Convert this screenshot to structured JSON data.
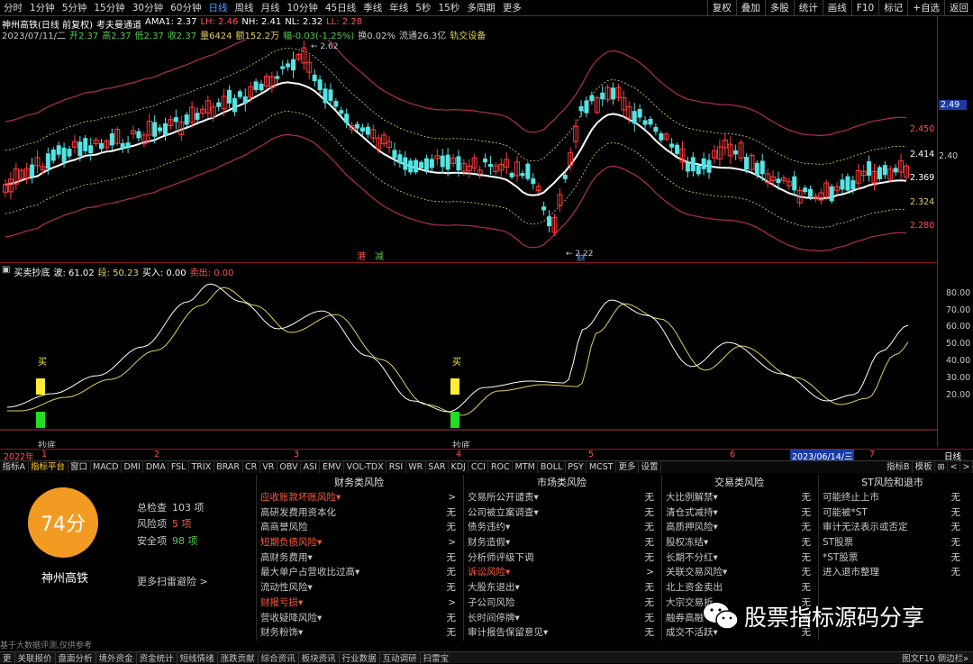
{
  "toolbar": {
    "periods": [
      "分时",
      "1分钟",
      "5分钟",
      "15分钟",
      "30分钟",
      "60分钟",
      "日线",
      "周线",
      "月线",
      "10分钟",
      "45日线",
      "季线",
      "年线",
      "5秒",
      "15秒",
      "多周期",
      "更多"
    ],
    "active_period": "日线",
    "right_buttons": [
      "复权",
      "叠加",
      "多股",
      "统计",
      "画线",
      "F10",
      "标记",
      "+自选",
      "返回"
    ]
  },
  "main_chart": {
    "name": "神州高铁(日线 前复权)",
    "indicator_name": "考夫曼通道",
    "ama_label": "AMA1: 2.37",
    "lh_label": "LH: 2.46",
    "nh_label": "NH: 2.41",
    "nl_label": "NL: 2.32",
    "ll_label": "LL: 2.28",
    "quote_date": "2023/07/11/二",
    "open": "开2.37",
    "high": "高2.37",
    "low": "低2.37",
    "close": "收2.37",
    "volume": "量6424",
    "amount": "额152.2万",
    "change": "幅-0.03(-1.25%)",
    "turnover": "换0.02%",
    "float_cap": "流通26.3亿",
    "sector": "轨交设备",
    "high_mark": "2.62",
    "low_mark": "2.22",
    "marker_1": "港",
    "marker_2": "减",
    "marker_3": "财",
    "axis_labels": [
      {
        "text": "2.49",
        "color": "#4a90ff"
      },
      {
        "text": "2.450",
        "color": "#ff5050"
      },
      {
        "text": "2.414",
        "color": "#ffffff"
      },
      {
        "text": "2.40",
        "color": "#c8c8c8"
      },
      {
        "text": "2.369",
        "color": "#ffffff"
      },
      {
        "text": "2.324",
        "color": "#e0d060"
      },
      {
        "text": "2.280",
        "color": "#ff5050"
      }
    ]
  },
  "sub_chart": {
    "name": "买卖抄底",
    "bo_label": "波: 61.02",
    "jue_label": "段: 50.23",
    "buy_label": "买入: 0.00",
    "sell_label": "卖出: 0.00",
    "buy_text": "买",
    "bottom_text": "抄底",
    "axis_labels": [
      "80.00",
      "70.00",
      "60.00",
      "50.00",
      "40.00",
      "30.00",
      "20.00"
    ]
  },
  "timeline": {
    "year": "2022年",
    "months": [
      "1",
      "2",
      "3",
      "4",
      "5",
      "6",
      "7"
    ],
    "cursor_date": "2023/06/14/三",
    "right_label": "日线"
  },
  "bottom_tabs": [
    "指标A",
    "指标平台",
    "窗口",
    "MACD",
    "DMI",
    "DMA",
    "FSL",
    "TRIX",
    "BRAR",
    "CR",
    "VR",
    "OBV",
    "ASI",
    "EMV",
    "VOL-TDX",
    "RSI",
    "WR",
    "SAR",
    "KDJ",
    "CCI",
    "ROC",
    "MTM",
    "BOLL",
    "PSY",
    "MCST",
    "更多",
    "设置"
  ],
  "bottom_tabs_right": [
    "指标B",
    "模板",
    "⊞",
    "<",
    ">"
  ],
  "score_panel": {
    "score": "74分",
    "name": "神州高铁",
    "total_label": "总检查",
    "total_value": "103 项",
    "risk_label": "风险项",
    "risk_value": "5 项",
    "safe_label": "安全项",
    "safe_value": "98 项",
    "more_link": "更多扫雷避险 >"
  },
  "risk_columns": [
    {
      "title": "财务类风险",
      "items": [
        {
          "label": "应收账款坏账风险▾",
          "value": ">",
          "alert": true
        },
        {
          "label": "高研发费用资本化",
          "value": "无",
          "alert": false
        },
        {
          "label": "高商誉风险",
          "value": "无",
          "alert": false
        },
        {
          "label": "短期负债风险▾",
          "value": ">",
          "alert": true
        },
        {
          "label": "高财务费用▾",
          "value": "无",
          "alert": false
        },
        {
          "label": "最大单户占营收比过高▾",
          "value": "无",
          "alert": false
        },
        {
          "label": "流动性风险▾",
          "value": "无",
          "alert": false
        },
        {
          "label": "财报亏损▾",
          "value": ">",
          "alert": true
        },
        {
          "label": "营收疑降风险▾",
          "value": "无",
          "alert": false
        },
        {
          "label": "财务粉饰▾",
          "value": "无",
          "alert": false
        }
      ]
    },
    {
      "title": "市场类风险",
      "items": [
        {
          "label": "交易所公开谴责▾",
          "value": "无",
          "alert": false
        },
        {
          "label": "公司被立案调查▾",
          "value": "无",
          "alert": false
        },
        {
          "label": "债务违约▾",
          "value": "无",
          "alert": false
        },
        {
          "label": "财务造假▾",
          "value": "无",
          "alert": false
        },
        {
          "label": "分析师评级下调",
          "value": "无",
          "alert": false
        },
        {
          "label": "诉讼风险▾",
          "value": ">",
          "alert": true
        },
        {
          "label": "大股东退出▾",
          "value": "无",
          "alert": false
        },
        {
          "label": "子公司风险",
          "value": "无",
          "alert": false
        },
        {
          "label": "长时间停牌▾",
          "value": "无",
          "alert": false
        },
        {
          "label": "审计报告保留意见▾",
          "value": "无",
          "alert": false
        }
      ]
    },
    {
      "title": "交易类风险",
      "items": [
        {
          "label": "大比例解禁▾",
          "value": "无",
          "alert": false
        },
        {
          "label": "清仓式减持▾",
          "value": "无",
          "alert": false
        },
        {
          "label": "高质押风险▾",
          "value": "无",
          "alert": false
        },
        {
          "label": "股权冻结▾",
          "value": "无",
          "alert": false
        },
        {
          "label": "长期不分红▾",
          "value": "无",
          "alert": false
        },
        {
          "label": "关联交易风险▾",
          "value": "无",
          "alert": false
        },
        {
          "label": "北上资金卖出",
          "value": "无",
          "alert": false
        },
        {
          "label": "大宗交易折",
          "value": "无",
          "alert": false
        },
        {
          "label": "融券高融",
          "value": "无",
          "alert": false
        },
        {
          "label": "成交不活跃▾",
          "value": "无",
          "alert": false
        }
      ]
    },
    {
      "title": "ST风险和退市",
      "items": [
        {
          "label": "可能终止上市",
          "value": "无",
          "alert": false
        },
        {
          "label": "可能被*ST",
          "value": "无",
          "alert": false
        },
        {
          "label": "审计无法表示或否定",
          "value": "无",
          "alert": false
        },
        {
          "label": "ST股票",
          "value": "无",
          "alert": false
        },
        {
          "label": "*ST股票",
          "value": "无",
          "alert": false
        },
        {
          "label": "进入退市整理",
          "value": "无",
          "alert": false
        }
      ]
    }
  ],
  "footnote": "基于大数据评测,仅供参考",
  "watermark": "股票指标源码分享",
  "status_bar": [
    "关联报价",
    "盘面分析",
    "境外资金",
    "资金统计",
    "短线情绪",
    "涨跌贡献",
    "综合资讯",
    "板块资讯",
    "行业数据",
    "互动调研",
    "扫雷宝"
  ],
  "status_left": "更",
  "status_right": "图文F10 倒边栏»"
}
